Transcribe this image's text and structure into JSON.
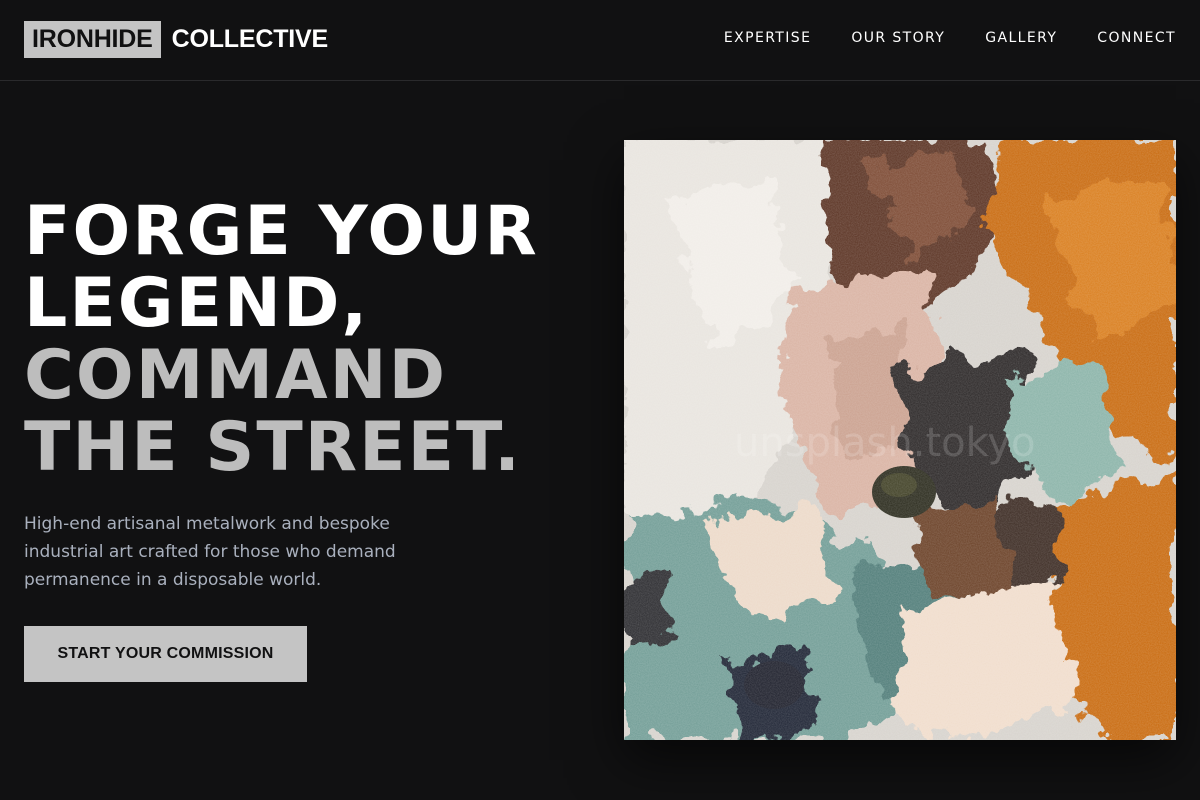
{
  "header": {
    "logo_box": "IRONHIDE",
    "logo_rest": "COLLECTIVE",
    "nav": [
      "EXPERTISE",
      "OUR STORY",
      "GALLERY",
      "CONNECT"
    ]
  },
  "hero": {
    "title_lines": [
      "FORGE YOUR",
      "LEGEND,",
      "COMMAND",
      "THE STREET."
    ],
    "subtitle": "High-end artisanal metalwork and bespoke industrial art crafted for those who demand permanence in a disposable world.",
    "cta_label": "START YOUR COMMISSION"
  },
  "artwork": {
    "watermark": "unsplash.tokyo"
  },
  "colors": {
    "background": "#111112",
    "accent": "#c4c4c4",
    "subtitle": "#a9b0bd",
    "paint_orange": "#c8690f",
    "paint_teal": "#6f9c95",
    "paint_brown": "#5a3322"
  }
}
